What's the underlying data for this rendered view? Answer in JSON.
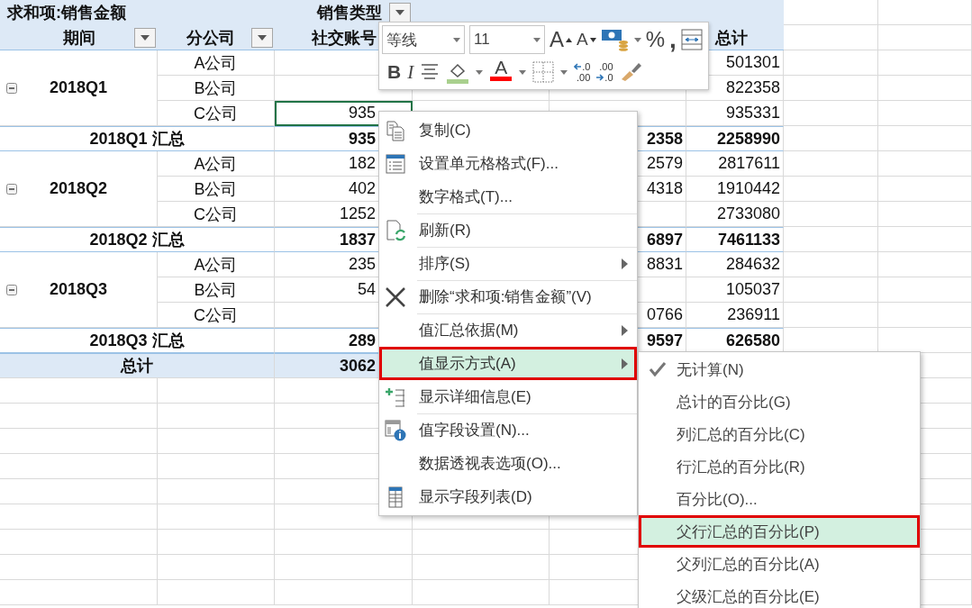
{
  "pivot": {
    "title": "求和项:销售金额",
    "column_field": "销售类型",
    "row_fields": [
      "期间",
      "分公司"
    ],
    "column_item": "社交账号",
    "total_label": "总计"
  },
  "groups": [
    {
      "period": "2018Q1",
      "expanded": true,
      "rows": [
        {
          "company": "A公司",
          "total": "501301",
          "selected": false
        },
        {
          "company": "B公司",
          "total": "822358",
          "selected": false
        },
        {
          "company": "C公司",
          "value": "935",
          "total": "935331",
          "selected": true
        }
      ],
      "subtotal": {
        "label": "2018Q1 汇总",
        "value": "935",
        "value_2": "2358",
        "total": "2258990"
      }
    },
    {
      "period": "2018Q2",
      "expanded": true,
      "rows": [
        {
          "company": "A公司",
          "value": "182",
          "value_2": "2579",
          "total": "2817611",
          "selected": false
        },
        {
          "company": "B公司",
          "value": "402",
          "value_2": "4318",
          "total": "1910442",
          "selected": false
        },
        {
          "company": "C公司",
          "value": "1252",
          "total": "2733080",
          "selected": false
        }
      ],
      "subtotal": {
        "label": "2018Q2 汇总",
        "value": "1837",
        "value_2": "6897",
        "total": "7461133"
      }
    },
    {
      "period": "2018Q3",
      "expanded": true,
      "rows": [
        {
          "company": "A公司",
          "value": "235",
          "value_2": "8831",
          "total": "284632",
          "selected": false
        },
        {
          "company": "B公司",
          "value": "54",
          "total": "105037",
          "selected": false
        },
        {
          "company": "C公司",
          "value_2": "0766",
          "total": "236911",
          "selected": false
        }
      ],
      "subtotal": {
        "label": "2018Q3 汇总",
        "value": "289",
        "value_2": "9597",
        "total": "626580"
      }
    }
  ],
  "grand_total": {
    "label": "总计",
    "value": "3062"
  },
  "mini_toolbar": {
    "font": "等线",
    "size": "11",
    "row_1": [
      {
        "kind": "grow_font",
        "label": "A"
      },
      {
        "kind": "shrink_font",
        "label": "A"
      },
      {
        "kind": "accounting"
      },
      {
        "kind": "percent",
        "label": "%"
      },
      {
        "kind": "comma",
        "label": ","
      },
      {
        "kind": "wrap"
      }
    ],
    "row_2": [
      {
        "kind": "bold",
        "label": "B"
      },
      {
        "kind": "italic",
        "label": "I"
      },
      {
        "kind": "center"
      },
      {
        "kind": "fill_color",
        "color": "#a9d08e"
      },
      {
        "kind": "font_color",
        "label": "A",
        "color": "#ff0000"
      },
      {
        "kind": "borders"
      },
      {
        "kind": "increase_decimal",
        "label": ".0",
        "label_2": ".00"
      },
      {
        "kind": "decrease_decimal",
        "label": ".00",
        "label_2": ".0"
      },
      {
        "kind": "format_painter"
      }
    ]
  },
  "context_menu": [
    {
      "label": "复制(C)",
      "kind": "copy",
      "separator_before": false,
      "has_submenu": false,
      "selected": false
    },
    {
      "label": "设置单元格格式(F)...",
      "kind": "format_cells",
      "separator_before": false,
      "has_submenu": false,
      "selected": false
    },
    {
      "label": "数字格式(T)...",
      "kind": "plain",
      "separator_before": false,
      "has_submenu": false,
      "selected": false
    },
    {
      "label": "刷新(R)",
      "kind": "refresh",
      "separator_before": true,
      "has_submenu": false,
      "selected": false
    },
    {
      "label": "排序(S)",
      "kind": "plain",
      "separator_before": true,
      "has_submenu": true,
      "selected": false
    },
    {
      "label": "删除“求和项:销售金额”(V)",
      "kind": "delete",
      "separator_before": true,
      "has_submenu": false,
      "selected": false
    },
    {
      "label": "值汇总依据(M)",
      "kind": "plain",
      "separator_before": true,
      "has_submenu": true,
      "selected": false
    },
    {
      "label": "值显示方式(A)",
      "kind": "plain",
      "separator_before": false,
      "has_submenu": true,
      "selected": true
    },
    {
      "label": "显示详细信息(E)",
      "kind": "details",
      "separator_before": false,
      "has_submenu": false,
      "selected": false
    },
    {
      "label": "值字段设置(N)...",
      "kind": "field_settings",
      "separator_before": true,
      "has_submenu": false,
      "selected": false
    },
    {
      "label": "数据透视表选项(O)...",
      "kind": "plain",
      "separator_before": false,
      "has_submenu": false,
      "selected": false
    },
    {
      "label": "显示字段列表(D)",
      "kind": "field_list",
      "separator_before": false,
      "has_submenu": false,
      "selected": false
    }
  ],
  "submenu": [
    {
      "label": "无计算(N)",
      "checked": true,
      "selected": false
    },
    {
      "label": "总计的百分比(G)",
      "checked": false,
      "selected": false
    },
    {
      "label": "列汇总的百分比(C)",
      "checked": false,
      "selected": false
    },
    {
      "label": "行汇总的百分比(R)",
      "checked": false,
      "selected": false
    },
    {
      "label": "百分比(O)...",
      "checked": false,
      "selected": false
    },
    {
      "label": "父行汇总的百分比(P)",
      "checked": false,
      "selected": true
    },
    {
      "label": "父列汇总的百分比(A)",
      "checked": false,
      "selected": false
    },
    {
      "label": "父级汇总的百分比(E)",
      "checked": false,
      "selected": false
    }
  ]
}
